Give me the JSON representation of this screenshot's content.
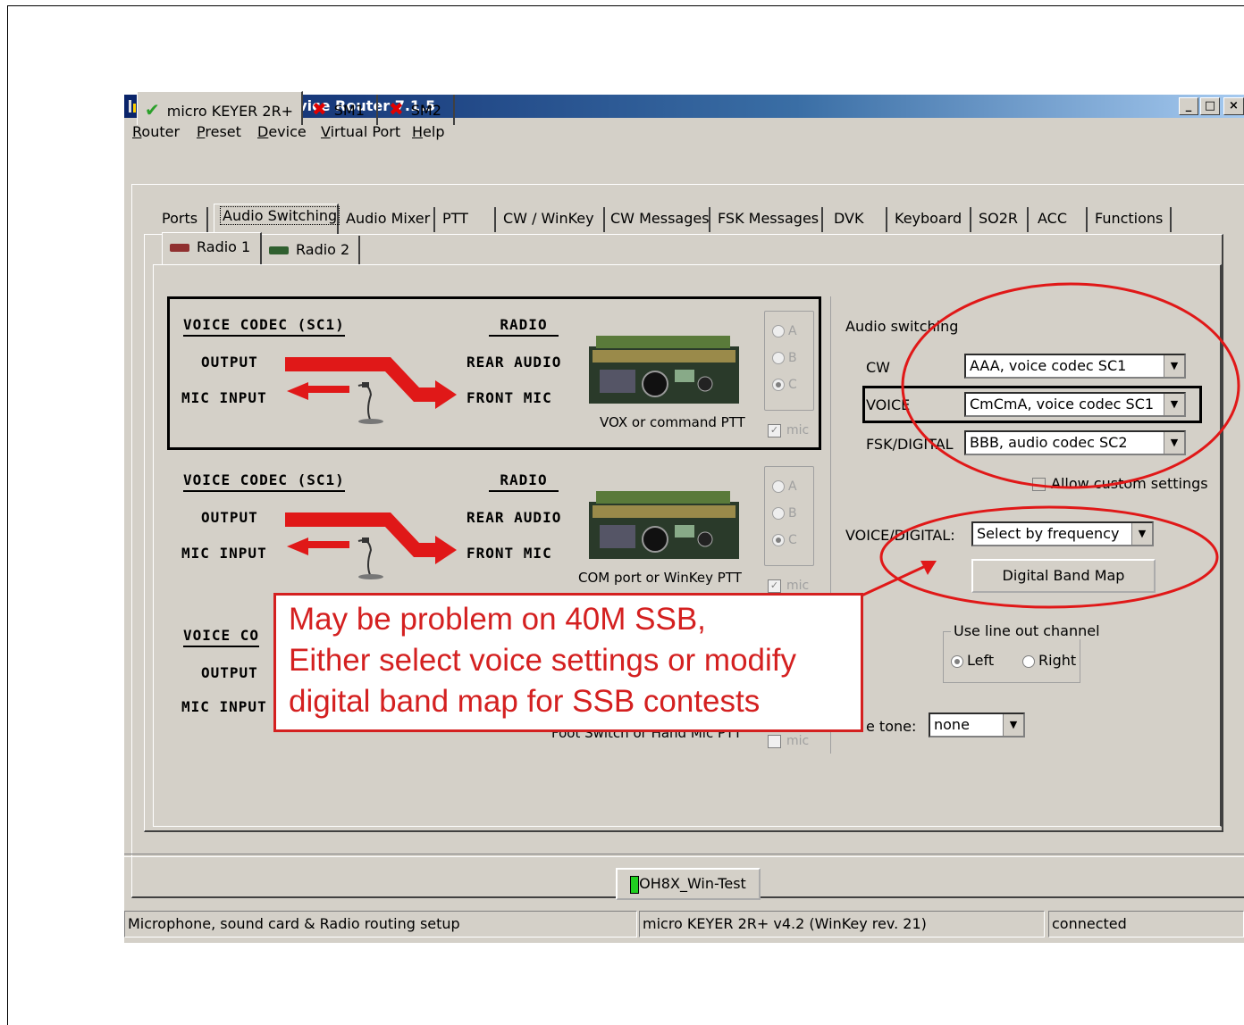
{
  "window": {
    "title": "microHAM USB Device Router 7.1.5",
    "controls": [
      "_",
      "□",
      "×"
    ]
  },
  "menu": [
    "Router",
    "Preset",
    "Device",
    "Virtual Port",
    "Help"
  ],
  "device_tabs": [
    {
      "label": "micro KEYER 2R+",
      "status": "check",
      "active": true
    },
    {
      "label": "SM1",
      "status": "cross"
    },
    {
      "label": "SM2",
      "status": "cross"
    }
  ],
  "function_tabs": [
    "Ports",
    "Audio Switching",
    "Audio Mixer",
    "PTT",
    "CW / WinKey",
    "CW Messages",
    "FSK Messages",
    "DVK",
    "Keyboard",
    "SO2R",
    "ACC",
    "Functions"
  ],
  "radio_tabs": [
    "Radio 1",
    "Radio 2"
  ],
  "blocks": [
    {
      "codec_header": "VOICE CODEC (SC1)",
      "radio_header": "RADIO",
      "output": "OUTPUT",
      "mic_input": "MIC INPUT",
      "rear_audio": "REAR AUDIO",
      "front_mic": "FRONT MIC",
      "caption": "VOX or command PTT",
      "options": [
        "A",
        "B",
        "C"
      ],
      "selected": "C",
      "mic_label": "mic"
    },
    {
      "codec_header": "VOICE CODEC (SC1)",
      "radio_header": "RADIO",
      "output": "OUTPUT",
      "mic_input": "MIC INPUT",
      "rear_audio": "REAR AUDIO",
      "front_mic": "FRONT MIC",
      "caption": "COM port or WinKey PTT",
      "options": [
        "A",
        "B",
        "C"
      ],
      "selected": "C",
      "mic_label": "mic"
    },
    {
      "codec_header": "VOICE CO",
      "output": "OUTPUT",
      "mic_input": "MIC INPUT",
      "caption": "Foot Switch or Hand Mic PTT",
      "mic_label": "mic"
    }
  ],
  "audio_switching": {
    "title": "Audio switching",
    "rows": [
      {
        "label": "CW",
        "value": "AAA, voice codec SC1"
      },
      {
        "label": "VOICE",
        "value": "CmCmA, voice codec SC1"
      },
      {
        "label": "FSK/DIGITAL",
        "value": "BBB, audio codec SC2"
      }
    ],
    "allow_custom": "Allow custom settings"
  },
  "voice_digital": {
    "label": "VOICE/DIGITAL:",
    "value": "Select by frequency",
    "band_map_button": "Digital Band Map"
  },
  "line_out": {
    "title": "Use line out channel",
    "left": "Left",
    "right": "Right",
    "selected": "Left"
  },
  "tone": {
    "label": "e tone:",
    "value": "none"
  },
  "preset_button": "OH8X_Win-Test",
  "status_bar": [
    "Microphone, sound card & Radio routing setup",
    "micro KEYER 2R+ v4.2 (WinKey rev. 21)",
    "connected"
  ],
  "annotation": {
    "lines": [
      "May be problem on 40M SSB,",
      "Either select voice settings or modify",
      "digital band map for SSB contests"
    ],
    "color": "#d42020"
  }
}
